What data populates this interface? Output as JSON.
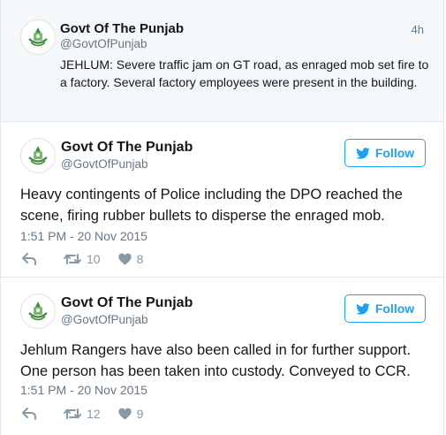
{
  "parent_tweet": {
    "author_name": "Govt Of The Punjab",
    "handle": "@GovtOfPunjab",
    "time": "4h",
    "text": "JEHLUM: Severe traffic jam on GT road, as enraged mob set fire to a factory. Several factory employees were present in the building."
  },
  "tweets": [
    {
      "author_name": "Govt Of The Punjab",
      "handle": "@GovtOfPunjab",
      "follow_label": "Follow",
      "text": "Heavy contingents of Police including the DPO reached the scene, firing rubber bullets to disperse the enraged mob.",
      "timestamp": "1:51 PM - 20 Nov 2015",
      "retweets": "10",
      "likes": "8"
    },
    {
      "author_name": "Govt Of The Punjab",
      "handle": "@GovtOfPunjab",
      "follow_label": "Follow",
      "text": "Jehlum Rangers have also been called in for further support. One person has been taken into custody. Conveyed to CCR.",
      "timestamp": "1:51 PM - 20 Nov 2015",
      "retweets": "12",
      "likes": "9"
    }
  ],
  "colors": {
    "accent": "#1da1f2",
    "muted": "#657786",
    "icon": "#8899a6",
    "parent_bg": "#f5f8fa"
  },
  "icons": {
    "avatar": "punjab-emblem-icon",
    "follow": "bird-icon",
    "reply": "reply-icon",
    "retweet": "retweet-icon",
    "like": "heart-icon"
  }
}
